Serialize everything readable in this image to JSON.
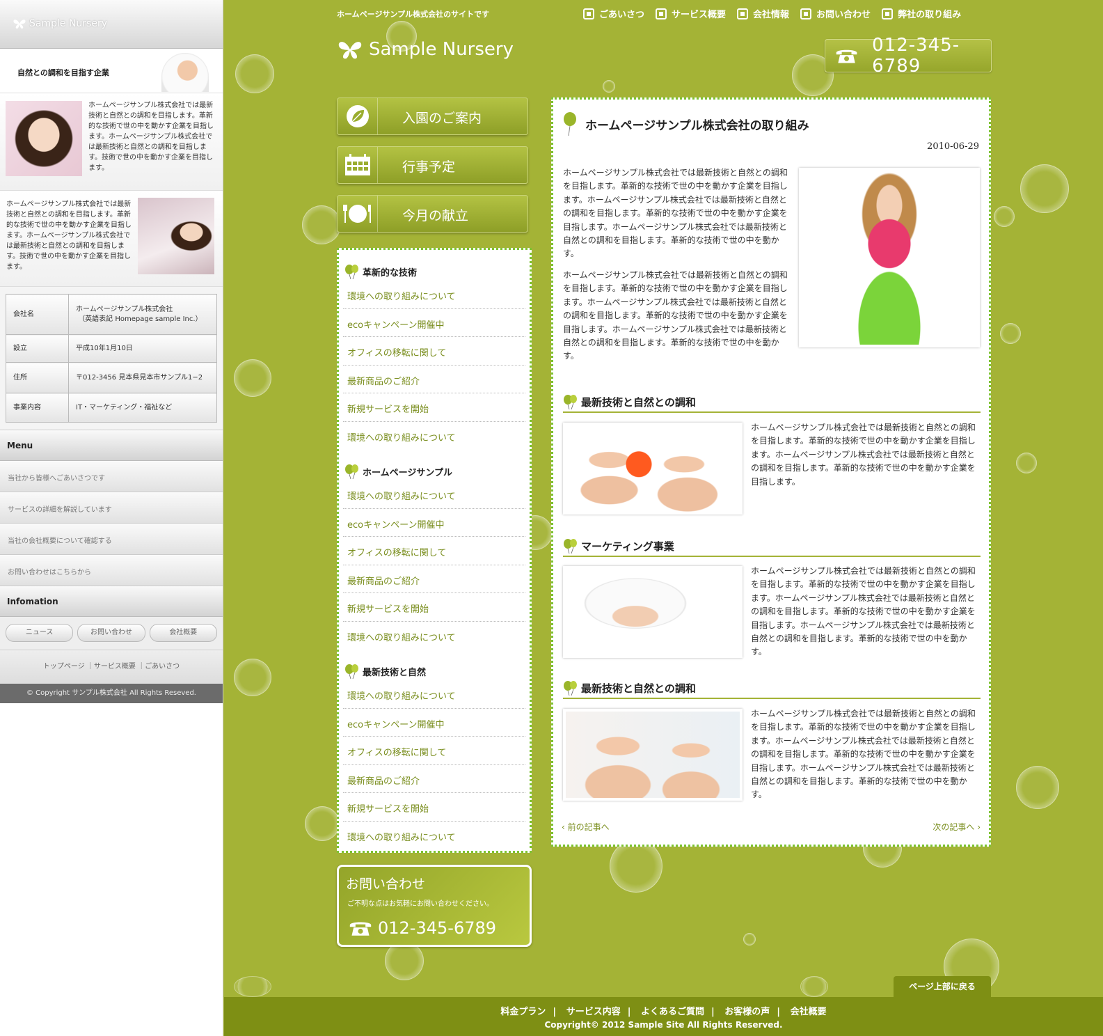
{
  "mobile": {
    "logo": "Sample Nursery",
    "banner_text": "自然との調和を目指す企業",
    "section1_text": "ホームページサンプル株式会社では最新技術と自然との調和を目指します。革新的な技術で世の中を動かす企業を目指します。ホームページサンプル株式会社では最新技術と自然との調和を目指します。技術で世の中を動かす企業を目指します。",
    "section2_text": "ホームページサンプル株式会社では最新技術と自然との調和を目指します。革新的な技術で世の中を動かす企業を目指します。ホームページサンプル株式会社では最新技術と自然との調和を目指します。技術で世の中を動かす企業を目指します。",
    "company_table": [
      {
        "key": "会社名",
        "value": "ホームページサンプル株式会社",
        "value2": "（英語表記 Homepage sample Inc.）"
      },
      {
        "key": "設立",
        "value": "平成10年1月10日",
        "value2": ""
      },
      {
        "key": "住所",
        "value": "〒012-3456 見本県見本市サンプル1−2",
        "value2": ""
      },
      {
        "key": "事業内容",
        "value": "IT・マーケティング・福祉など",
        "value2": ""
      }
    ],
    "menu_heading": "Menu",
    "menu_items": [
      "当社から皆様へごあいさつです",
      "サービスの詳細を解説しています",
      "当社の会社概要について確認する",
      "お問い合わせはこちらから"
    ],
    "info_heading": "Infomation",
    "info_buttons": [
      "ニュース",
      "お問い合わせ",
      "会社概要"
    ],
    "footer_links": "トップページ ｜サービス概要 ｜ごあいさつ",
    "copyright": "© Copyright サンプル株式会社 All Rights Reseved."
  },
  "header": {
    "tagline": "ホームページサンプル株式会社のサイトです",
    "nav": [
      "ごあいさつ",
      "サービス概要",
      "会社情報",
      "お問い合わせ",
      "弊社の取り組み"
    ],
    "logo": "Sample Nursery",
    "phone": "012-345-6789"
  },
  "bignav": [
    "入園のご案内",
    "行事予定",
    "今月の献立"
  ],
  "sidemenu": [
    {
      "title": "革新的な技術",
      "items": [
        "環境への取り組みについて",
        "ecoキャンペーン開催中",
        "オフィスの移転に関して",
        "最新商品のご紹介",
        "新規サービスを開始",
        "環境への取り組みについて"
      ]
    },
    {
      "title": "ホームページサンプル",
      "items": [
        "環境への取り組みについて",
        "ecoキャンペーン開催中",
        "オフィスの移転に関して",
        "最新商品のご紹介",
        "新規サービスを開始",
        "環境への取り組みについて"
      ]
    },
    {
      "title": "最新技術と自然",
      "items": [
        "環境への取り組みについて",
        "ecoキャンペーン開催中",
        "オフィスの移転に関して",
        "最新商品のご紹介",
        "新規サービスを開始",
        "環境への取り組みについて"
      ]
    }
  ],
  "contact": {
    "title": "お問い合わせ",
    "sub": "ご不明な点はお気軽にお問い合わせください。",
    "phone": "012-345-6789"
  },
  "article": {
    "title": "ホームページサンプル株式会社の取り組み",
    "date": "2010-06-29",
    "para1": "ホームページサンプル株式会社では最新技術と自然との調和を目指します。革新的な技術で世の中を動かす企業を目指します。ホームページサンプル株式会社では最新技術と自然との調和を目指します。革新的な技術で世の中を動かす企業を目指します。ホームページサンプル株式会社では最新技術と自然との調和を目指します。革新的な技術で世の中を動かす。",
    "para2": "ホームページサンプル株式会社では最新技術と自然との調和を目指します。革新的な技術で世の中を動かす企業を目指します。ホームページサンプル株式会社では最新技術と自然との調和を目指します。革新的な技術で世の中を動かす企業を目指します。ホームページサンプル株式会社では最新技術と自然との調和を目指します。革新的な技術で世の中を動かす。",
    "sections": [
      {
        "heading": "最新技術と自然との調和",
        "text": "ホームページサンプル株式会社では最新技術と自然との調和を目指します。革新的な技術で世の中を動かす企業を目指します。ホームページサンプル株式会社では最新技術と自然との調和を目指します。革新的な技術で世の中を動かす企業を目指します。"
      },
      {
        "heading": "マーケティング事業",
        "text": "ホームページサンプル株式会社では最新技術と自然との調和を目指します。革新的な技術で世の中を動かす企業を目指します。ホームページサンプル株式会社では最新技術と自然との調和を目指します。革新的な技術で世の中を動かす企業を目指します。ホームページサンプル株式会社では最新技術と自然との調和を目指します。革新的な技術で世の中を動かす。"
      },
      {
        "heading": "最新技術と自然との調和",
        "text": "ホームページサンプル株式会社では最新技術と自然との調和を目指します。革新的な技術で世の中を動かす企業を目指します。ホームページサンプル株式会社では最新技術と自然との調和を目指します。革新的な技術で世の中を動かす企業を目指します。ホームページサンプル株式会社では最新技術と自然との調和を目指します。革新的な技術で世の中を動かす。"
      }
    ],
    "prev": "前の記事へ",
    "next": "次の記事へ"
  },
  "back_to_top": "ページ上部に戻る",
  "footer": {
    "links": [
      "料金プラン",
      "サービス内容",
      "よくあるご質問",
      "お客様の声",
      "会社概要"
    ],
    "copyright": "Copyright© 2012 Sample Site All Rights Reserved."
  },
  "colors": {
    "background": "#a4b336",
    "footer": "#7e8f14",
    "link": "#7a8e1e",
    "dotted_border": "#7cc331"
  }
}
